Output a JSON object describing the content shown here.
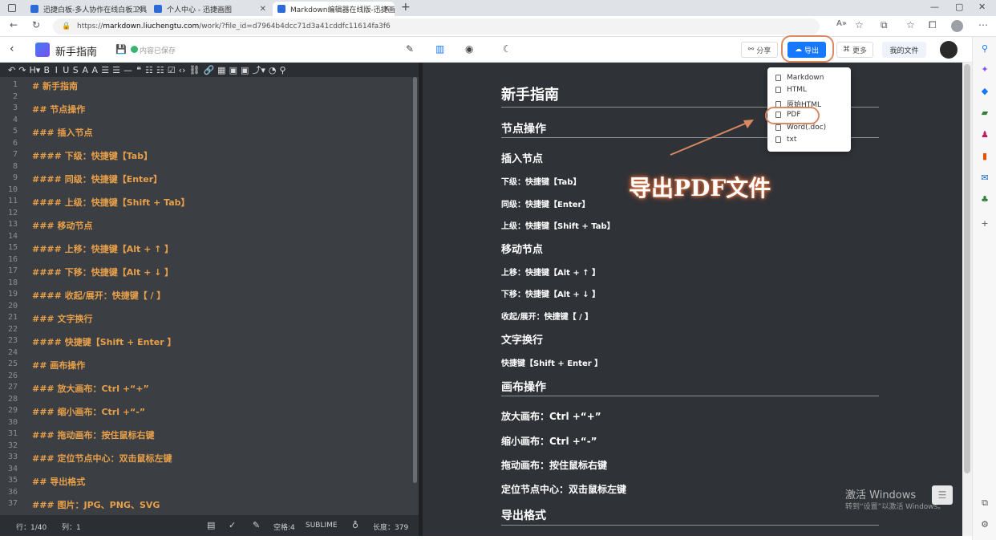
{
  "browser": {
    "tabs": [
      {
        "title": "迅捷白板-多人协作在线白板工具",
        "fav_color": "#2f6bd6"
      },
      {
        "title": "个人中心 - 迅捷画图",
        "fav_color": "#2f6bd6"
      },
      {
        "title": "Markdown编辑器在线版-迅捷画",
        "fav_color": "#2f6bd6"
      }
    ],
    "url_prefix": "https://",
    "url_host": "markdown.liuchengtu.com",
    "url_path": "/work/?file_id=d7964b4dcc71d3a41cddfc11614fa3f6"
  },
  "header": {
    "doc_title": "新手指南",
    "save_status": "内容已保存",
    "share_label": "分享",
    "export_label": "导出",
    "more_label": "更多",
    "my_files_label": "我的文件"
  },
  "toolbar": {
    "items": [
      "↶",
      "↷",
      "H▾",
      "B",
      "I",
      "U",
      "S",
      "A",
      "A",
      "☰",
      "☰",
      "—",
      "❝",
      "☷",
      "☷",
      "☑",
      "‹›",
      "⛓",
      "🔗",
      "▦",
      "▣",
      "▣",
      "⤴▾",
      "◔",
      "⚲"
    ]
  },
  "editor": {
    "lines": [
      {
        "n": "1",
        "text": "# 新手指南"
      },
      {
        "n": "2",
        "text": ""
      },
      {
        "n": "3",
        "text": "## 节点操作"
      },
      {
        "n": "4",
        "text": ""
      },
      {
        "n": "5",
        "text": "### 插入节点"
      },
      {
        "n": "6",
        "text": ""
      },
      {
        "n": "7",
        "text": "#### 下级：快捷键【Tab】"
      },
      {
        "n": "8",
        "text": ""
      },
      {
        "n": "9",
        "text": "#### 同级：快捷键【Enter】"
      },
      {
        "n": "10",
        "text": ""
      },
      {
        "n": "11",
        "text": "#### 上级：快捷键【Shift + Tab】"
      },
      {
        "n": "12",
        "text": ""
      },
      {
        "n": "13",
        "text": "### 移动节点"
      },
      {
        "n": "14",
        "text": ""
      },
      {
        "n": "15",
        "text": "#### 上移：快捷键【Alt + ↑ 】"
      },
      {
        "n": "16",
        "text": ""
      },
      {
        "n": "17",
        "text": "#### 下移：快捷键【Alt + ↓ 】"
      },
      {
        "n": "18",
        "text": ""
      },
      {
        "n": "19",
        "text": "#### 收起/展开：快捷键【 / 】"
      },
      {
        "n": "20",
        "text": ""
      },
      {
        "n": "21",
        "text": "### 文字换行"
      },
      {
        "n": "22",
        "text": ""
      },
      {
        "n": "23",
        "text": "#### 快捷键【Shift + Enter 】"
      },
      {
        "n": "24",
        "text": ""
      },
      {
        "n": "25",
        "text": "## 画布操作"
      },
      {
        "n": "26",
        "text": ""
      },
      {
        "n": "27",
        "text": "### 放大画布：Ctrl +“+”"
      },
      {
        "n": "28",
        "text": ""
      },
      {
        "n": "29",
        "text": "### 缩小画布：Ctrl +“-”"
      },
      {
        "n": "30",
        "text": ""
      },
      {
        "n": "31",
        "text": "### 拖动画布：按住鼠标右键"
      },
      {
        "n": "32",
        "text": ""
      },
      {
        "n": "33",
        "text": "### 定位节点中心：双击鼠标左键"
      },
      {
        "n": "34",
        "text": ""
      },
      {
        "n": "35",
        "text": "## 导出格式"
      },
      {
        "n": "36",
        "text": ""
      },
      {
        "n": "37",
        "text": "### 图片：JPG、PNG、SVG"
      }
    ]
  },
  "status": {
    "row": "行：1/40",
    "col": "列：1",
    "spaces": "空格:4",
    "mode": "SUBLIME",
    "length": "长度：379"
  },
  "preview": {
    "h1": "新手指南",
    "h2_nodes": "节点操作",
    "h3_insert": "插入节点",
    "l_lower": "下级：快捷键【Tab】",
    "l_same": "同级：快捷键【Enter】",
    "l_upper": "上级：快捷键【Shift + Tab】",
    "h3_move": "移动节点",
    "l_up": "上移：快捷键【Alt + ↑ 】",
    "l_down": "下移：快捷键【Alt + ↓ 】",
    "l_fold": "收起/展开：快捷键【 / 】",
    "h3_wrap": "文字换行",
    "l_wrap": "快捷键【Shift + Enter 】",
    "h2_canvas": "画布操作",
    "l_zoomin": "放大画布：Ctrl +“+”",
    "l_zoomout": "缩小画布：Ctrl +“-”",
    "l_drag": "拖动画布：按住鼠标右键",
    "l_center": "定位节点中心：双击鼠标左键",
    "h2_export": "导出格式"
  },
  "export_menu": [
    "Markdown",
    "HTML",
    "原始HTML",
    "PDF",
    "Word(.doc)",
    "txt"
  ],
  "annotation": {
    "callout": "导出PDF文件"
  },
  "watermark": {
    "line1": "激活 Windows",
    "line2": "转到“设置”以激活 Windows。"
  },
  "colors": {
    "accent": "#1677ff",
    "editor_text": "#e8a04a",
    "highlight": "#d98a62"
  }
}
